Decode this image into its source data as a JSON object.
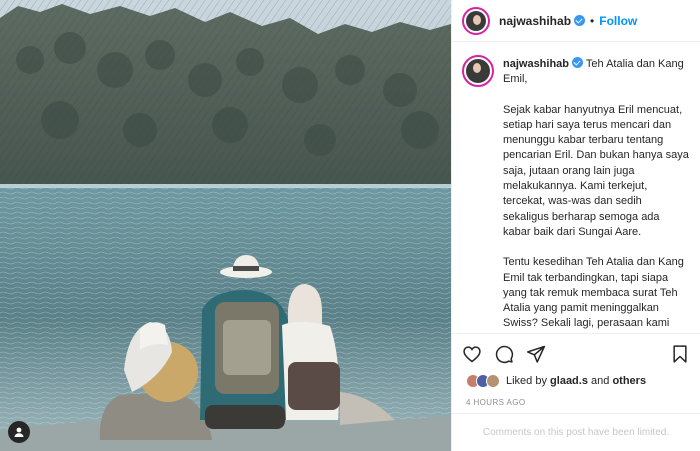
{
  "post": {
    "username": "najwashihab",
    "follow_label": "Follow",
    "separator": "•",
    "caption_greeting": "Teh Atalia dan Kang Emil,",
    "caption_paragraphs": [
      "Sejak kabar hanyutnya Eril mencuat, setiap hari saya terus mencari dan menunggu kabar terbaru tentang pencarian Eril. Dan bukan hanya saya saja, jutaan orang lain juga melakukannya. Kami terkejut, tercekat, was-was dan sedih sekaligus berharap semoga ada kabar baik dari Sungai Aare.",
      "Tentu kesedihan Teh Atalia dan Kang Emil tak terbandingkan, tapi siapa yang tak remuk membaca surat Teh Atalia yang pamit meninggalkan Swiss? Sekali lagi, perasaan kami tentu tak seberapa dibanding yang dirasakan Teh Atalia dan Kang Emil,"
    ],
    "likes_prefix": "Liked by",
    "likes_user": "glaad.s",
    "likes_and": "and",
    "likes_others": "others",
    "time_ago": "4 HOURS AGO",
    "comments_notice": "Comments on this post have been limited."
  },
  "icons": {
    "verified": "verified-badge-icon",
    "like": "heart-icon",
    "comment": "comment-icon",
    "share": "share-icon",
    "save": "bookmark-icon",
    "tag": "user-tag-icon"
  },
  "colors": {
    "accent": "#0095f6",
    "verified": "#3897f0",
    "muted": "#8e8e8e",
    "disabled_text": "#c7c7c7"
  }
}
